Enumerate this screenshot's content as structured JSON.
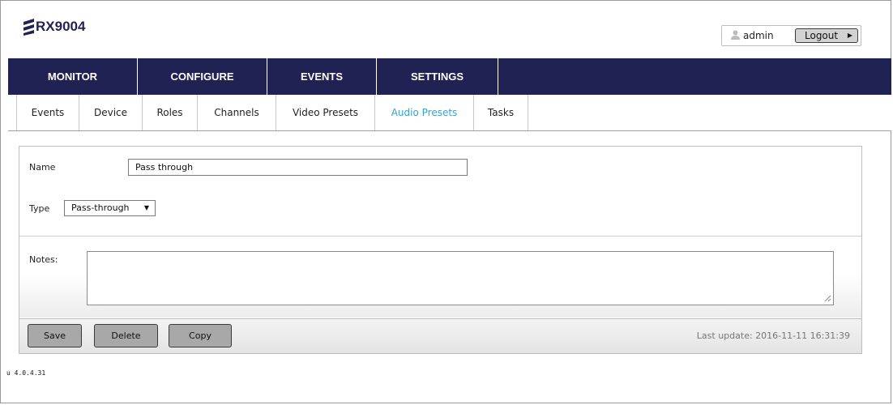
{
  "header": {
    "product": "RX9004",
    "user_name": "admin",
    "logout_label": "Logout",
    "brand_color": "#1f2252"
  },
  "main_nav": [
    {
      "label": "MONITOR"
    },
    {
      "label": "CONFIGURE"
    },
    {
      "label": "EVENTS"
    },
    {
      "label": "SETTINGS"
    }
  ],
  "sub_nav": [
    {
      "label": "Events"
    },
    {
      "label": "Device"
    },
    {
      "label": "Roles"
    },
    {
      "label": "Channels"
    },
    {
      "label": "Video Presets"
    },
    {
      "label": "Audio Presets",
      "active": true
    },
    {
      "label": "Tasks"
    }
  ],
  "form": {
    "name_label": "Name",
    "name_value": "Pass through",
    "type_label": "Type",
    "type_value": "Pass-through",
    "notes_label": "Notes:",
    "notes_value": ""
  },
  "actions": {
    "save": "Save",
    "delete": "Delete",
    "copy": "Copy",
    "last_update": "Last update: 2016-11-11 16:31:39"
  },
  "version": "u 4.0.4.31"
}
